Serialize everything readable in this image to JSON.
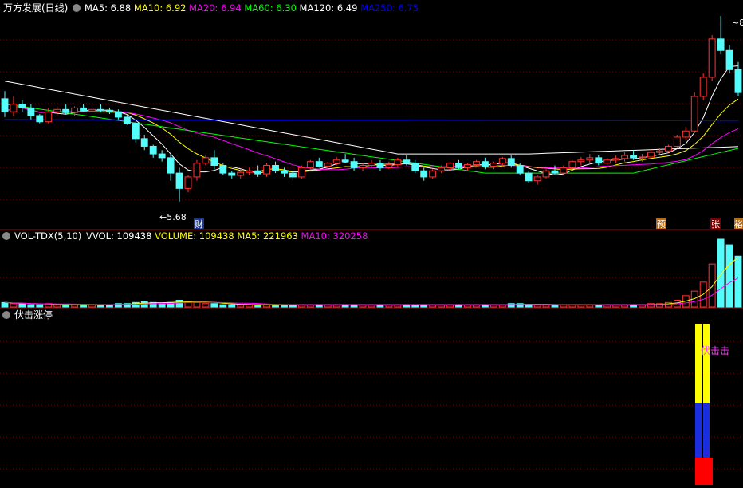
{
  "price_panel": {
    "title": "万方发展(日线)",
    "indicators": [
      {
        "label": "MA5: 6.88",
        "color": "#FFFFFF"
      },
      {
        "label": "MA10: 6.92",
        "color": "#FFFF00"
      },
      {
        "label": "MA20: 6.94",
        "color": "#FF00FF"
      },
      {
        "label": "MA60: 6.30",
        "color": "#00FF00"
      },
      {
        "label": "MA120: 6.49",
        "color": "#FFFFFF"
      },
      {
        "label": "MA250: 6.75",
        "color": "#0000FF"
      }
    ],
    "low_label": "5.68",
    "high_label": "8",
    "markers": [
      "财",
      "预",
      "张",
      "裕"
    ]
  },
  "volume_panel": {
    "title": "VOL-TDX(5,10)",
    "indicators": [
      {
        "label": "VVOL: 109438",
        "color": "#FFFFFF"
      },
      {
        "label": "VOLUME: 109438",
        "color": "#FFFF00"
      },
      {
        "label": "MA5: 221963",
        "color": "#FFFF00"
      },
      {
        "label": "MA10: 320258",
        "color": "#FF00FF"
      }
    ]
  },
  "signal_panel": {
    "title": "伏击涨停",
    "signal_label": "伏击击"
  },
  "colors": {
    "up": "#FF3333",
    "down": "#54FCFC",
    "grid": "#800000",
    "ma5": "#FFFFFF",
    "ma10": "#FFFF00",
    "ma20": "#FF00FF",
    "ma60": "#00FF00",
    "ma120": "#FFFFFF",
    "ma250": "#0000FF"
  },
  "chart_data": {
    "type": "candlestick",
    "price_range_estimate": [
      5.5,
      8.1
    ],
    "candles_estimate": [
      [
        7.02,
        7.12,
        6.78,
        6.85
      ],
      [
        6.85,
        7.05,
        6.8,
        6.95
      ],
      [
        6.95,
        7.0,
        6.85,
        6.9
      ],
      [
        6.9,
        6.95,
        6.75,
        6.8
      ],
      [
        6.8,
        6.82,
        6.7,
        6.72
      ],
      [
        6.72,
        6.9,
        6.7,
        6.85
      ],
      [
        6.85,
        6.92,
        6.8,
        6.88
      ],
      [
        6.88,
        6.95,
        6.82,
        6.84
      ],
      [
        6.84,
        6.92,
        6.8,
        6.9
      ],
      [
        6.9,
        6.95,
        6.85,
        6.86
      ],
      [
        6.86,
        6.92,
        6.82,
        6.88
      ],
      [
        6.88,
        6.95,
        6.84,
        6.87
      ],
      [
        6.87,
        6.9,
        6.82,
        6.85
      ],
      [
        6.85,
        6.88,
        6.75,
        6.78
      ],
      [
        6.78,
        6.82,
        6.68,
        6.7
      ],
      [
        6.7,
        6.72,
        6.45,
        6.5
      ],
      [
        6.5,
        6.55,
        6.35,
        6.4
      ],
      [
        6.4,
        6.42,
        6.25,
        6.3
      ],
      [
        6.3,
        6.35,
        6.2,
        6.25
      ],
      [
        6.25,
        6.3,
        5.95,
        6.05
      ],
      [
        6.05,
        6.12,
        5.68,
        5.85
      ],
      [
        5.85,
        6.02,
        5.8,
        6.0
      ],
      [
        6.0,
        6.22,
        5.95,
        6.18
      ],
      [
        6.18,
        6.28,
        6.15,
        6.25
      ],
      [
        6.25,
        6.35,
        6.1,
        6.15
      ],
      [
        6.15,
        6.18,
        6.02,
        6.05
      ],
      [
        6.05,
        6.08,
        5.98,
        6.02
      ],
      [
        6.02,
        6.1,
        5.98,
        6.06
      ],
      [
        6.06,
        6.12,
        6.02,
        6.08
      ],
      [
        6.08,
        6.15,
        6.0,
        6.04
      ],
      [
        6.04,
        6.18,
        6.0,
        6.15
      ],
      [
        6.15,
        6.2,
        6.05,
        6.08
      ],
      [
        6.08,
        6.12,
        6.0,
        6.05
      ],
      [
        6.05,
        6.1,
        5.95,
        6.0
      ],
      [
        6.0,
        6.15,
        5.98,
        6.12
      ],
      [
        6.12,
        6.22,
        6.1,
        6.2
      ],
      [
        6.2,
        6.25,
        6.12,
        6.14
      ],
      [
        6.14,
        6.2,
        6.1,
        6.18
      ],
      [
        6.18,
        6.26,
        6.15,
        6.22
      ],
      [
        6.22,
        6.3,
        6.18,
        6.2
      ],
      [
        6.2,
        6.25,
        6.08,
        6.12
      ],
      [
        6.12,
        6.18,
        6.08,
        6.15
      ],
      [
        6.15,
        6.22,
        6.12,
        6.18
      ],
      [
        6.18,
        6.22,
        6.08,
        6.12
      ],
      [
        6.12,
        6.2,
        6.1,
        6.16
      ],
      [
        6.16,
        6.25,
        6.12,
        6.22
      ],
      [
        6.22,
        6.28,
        6.15,
        6.18
      ],
      [
        6.18,
        6.22,
        6.05,
        6.08
      ],
      [
        6.08,
        6.12,
        5.95,
        6.0
      ],
      [
        6.0,
        6.1,
        5.98,
        6.08
      ],
      [
        6.08,
        6.15,
        6.05,
        6.12
      ],
      [
        6.12,
        6.2,
        6.08,
        6.18
      ],
      [
        6.18,
        6.22,
        6.1,
        6.12
      ],
      [
        6.12,
        6.18,
        6.08,
        6.16
      ],
      [
        6.16,
        6.22,
        6.12,
        6.2
      ],
      [
        6.2,
        6.25,
        6.1,
        6.14
      ],
      [
        6.14,
        6.2,
        6.1,
        6.18
      ],
      [
        6.18,
        6.26,
        6.14,
        6.24
      ],
      [
        6.24,
        6.28,
        6.12,
        6.15
      ],
      [
        6.15,
        6.18,
        6.02,
        6.05
      ],
      [
        6.05,
        6.08,
        5.92,
        5.95
      ],
      [
        5.95,
        6.02,
        5.9,
        6.0
      ],
      [
        6.0,
        6.1,
        5.98,
        6.08
      ],
      [
        6.08,
        6.15,
        6.02,
        6.05
      ],
      [
        6.05,
        6.15,
        6.02,
        6.12
      ],
      [
        6.12,
        6.22,
        6.1,
        6.2
      ],
      [
        6.2,
        6.26,
        6.15,
        6.22
      ],
      [
        6.22,
        6.3,
        6.18,
        6.25
      ],
      [
        6.25,
        6.28,
        6.15,
        6.18
      ],
      [
        6.18,
        6.25,
        6.15,
        6.22
      ],
      [
        6.22,
        6.28,
        6.18,
        6.24
      ],
      [
        6.24,
        6.32,
        6.2,
        6.28
      ],
      [
        6.28,
        6.35,
        6.22,
        6.25
      ],
      [
        6.25,
        6.3,
        6.2,
        6.26
      ],
      [
        6.26,
        6.35,
        6.24,
        6.32
      ],
      [
        6.32,
        6.38,
        6.3,
        6.34
      ],
      [
        6.34,
        6.42,
        6.32,
        6.4
      ],
      [
        6.4,
        6.55,
        6.38,
        6.52
      ],
      [
        6.52,
        6.65,
        6.48,
        6.6
      ],
      [
        6.6,
        7.1,
        6.58,
        7.05
      ],
      [
        7.05,
        7.35,
        7.0,
        7.3
      ],
      [
        7.3,
        7.85,
        7.25,
        7.8
      ],
      [
        7.8,
        8.1,
        7.6,
        7.65
      ],
      [
        7.65,
        7.72,
        7.35,
        7.4
      ],
      [
        7.4,
        7.5,
        7.05,
        7.1
      ]
    ],
    "volume_estimate": [
      4,
      3,
      3,
      2,
      2,
      3,
      2,
      2,
      2,
      2,
      2,
      2,
      2,
      3,
      3,
      4,
      5,
      4,
      3,
      4,
      6,
      5,
      4,
      3,
      3,
      2,
      2,
      2,
      2,
      2,
      2,
      2,
      2,
      2,
      2,
      2,
      2,
      2,
      2,
      2,
      2,
      2,
      2,
      2,
      2,
      2,
      2,
      2,
      2,
      2,
      2,
      2,
      2,
      2,
      2,
      2,
      2,
      2,
      3,
      3,
      2,
      2,
      2,
      2,
      2,
      2,
      2,
      2,
      2,
      2,
      2,
      2,
      2,
      2,
      3,
      3,
      4,
      6,
      10,
      14,
      22,
      38,
      60,
      55,
      45
    ],
    "signal_bars": [
      {
        "segment": "red"
      },
      {
        "segment": "blue"
      },
      {
        "segment": "yellow"
      }
    ]
  }
}
